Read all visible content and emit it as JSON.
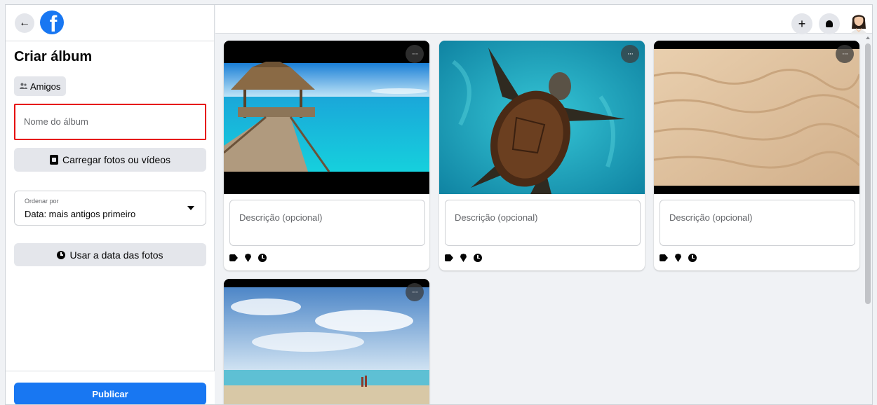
{
  "sidebar": {
    "back_glyph": "←",
    "logo_letter": "f",
    "title": "Criar álbum",
    "audience_label": "Amigos",
    "album_name_placeholder": "Nome do álbum",
    "upload_label": "Carregar fotos ou vídeos",
    "sort": {
      "label": "Ordenar por",
      "value": "Data: mais antigos primeiro"
    },
    "use_date_label": "Usar a data das fotos",
    "publish_label": "Publicar"
  },
  "header": {
    "add_glyph": "+",
    "icons": [
      "plus-icon",
      "bell-icon",
      "avatar"
    ]
  },
  "cards": [
    {
      "photo": "beach-pier-gazebo",
      "description_placeholder": "Descrição (opcional)",
      "more_glyph": "···"
    },
    {
      "photo": "sea-turtle",
      "description_placeholder": "Descrição (opcional)",
      "more_glyph": "···"
    },
    {
      "photo": "sand-dunes",
      "description_placeholder": "Descrição (opcional)",
      "more_glyph": "···"
    },
    {
      "photo": "beach-sky-people",
      "more_glyph": "···"
    }
  ],
  "colors": {
    "brand": "#1877f2",
    "highlight": "#e60000",
    "background": "#f0f2f5"
  }
}
